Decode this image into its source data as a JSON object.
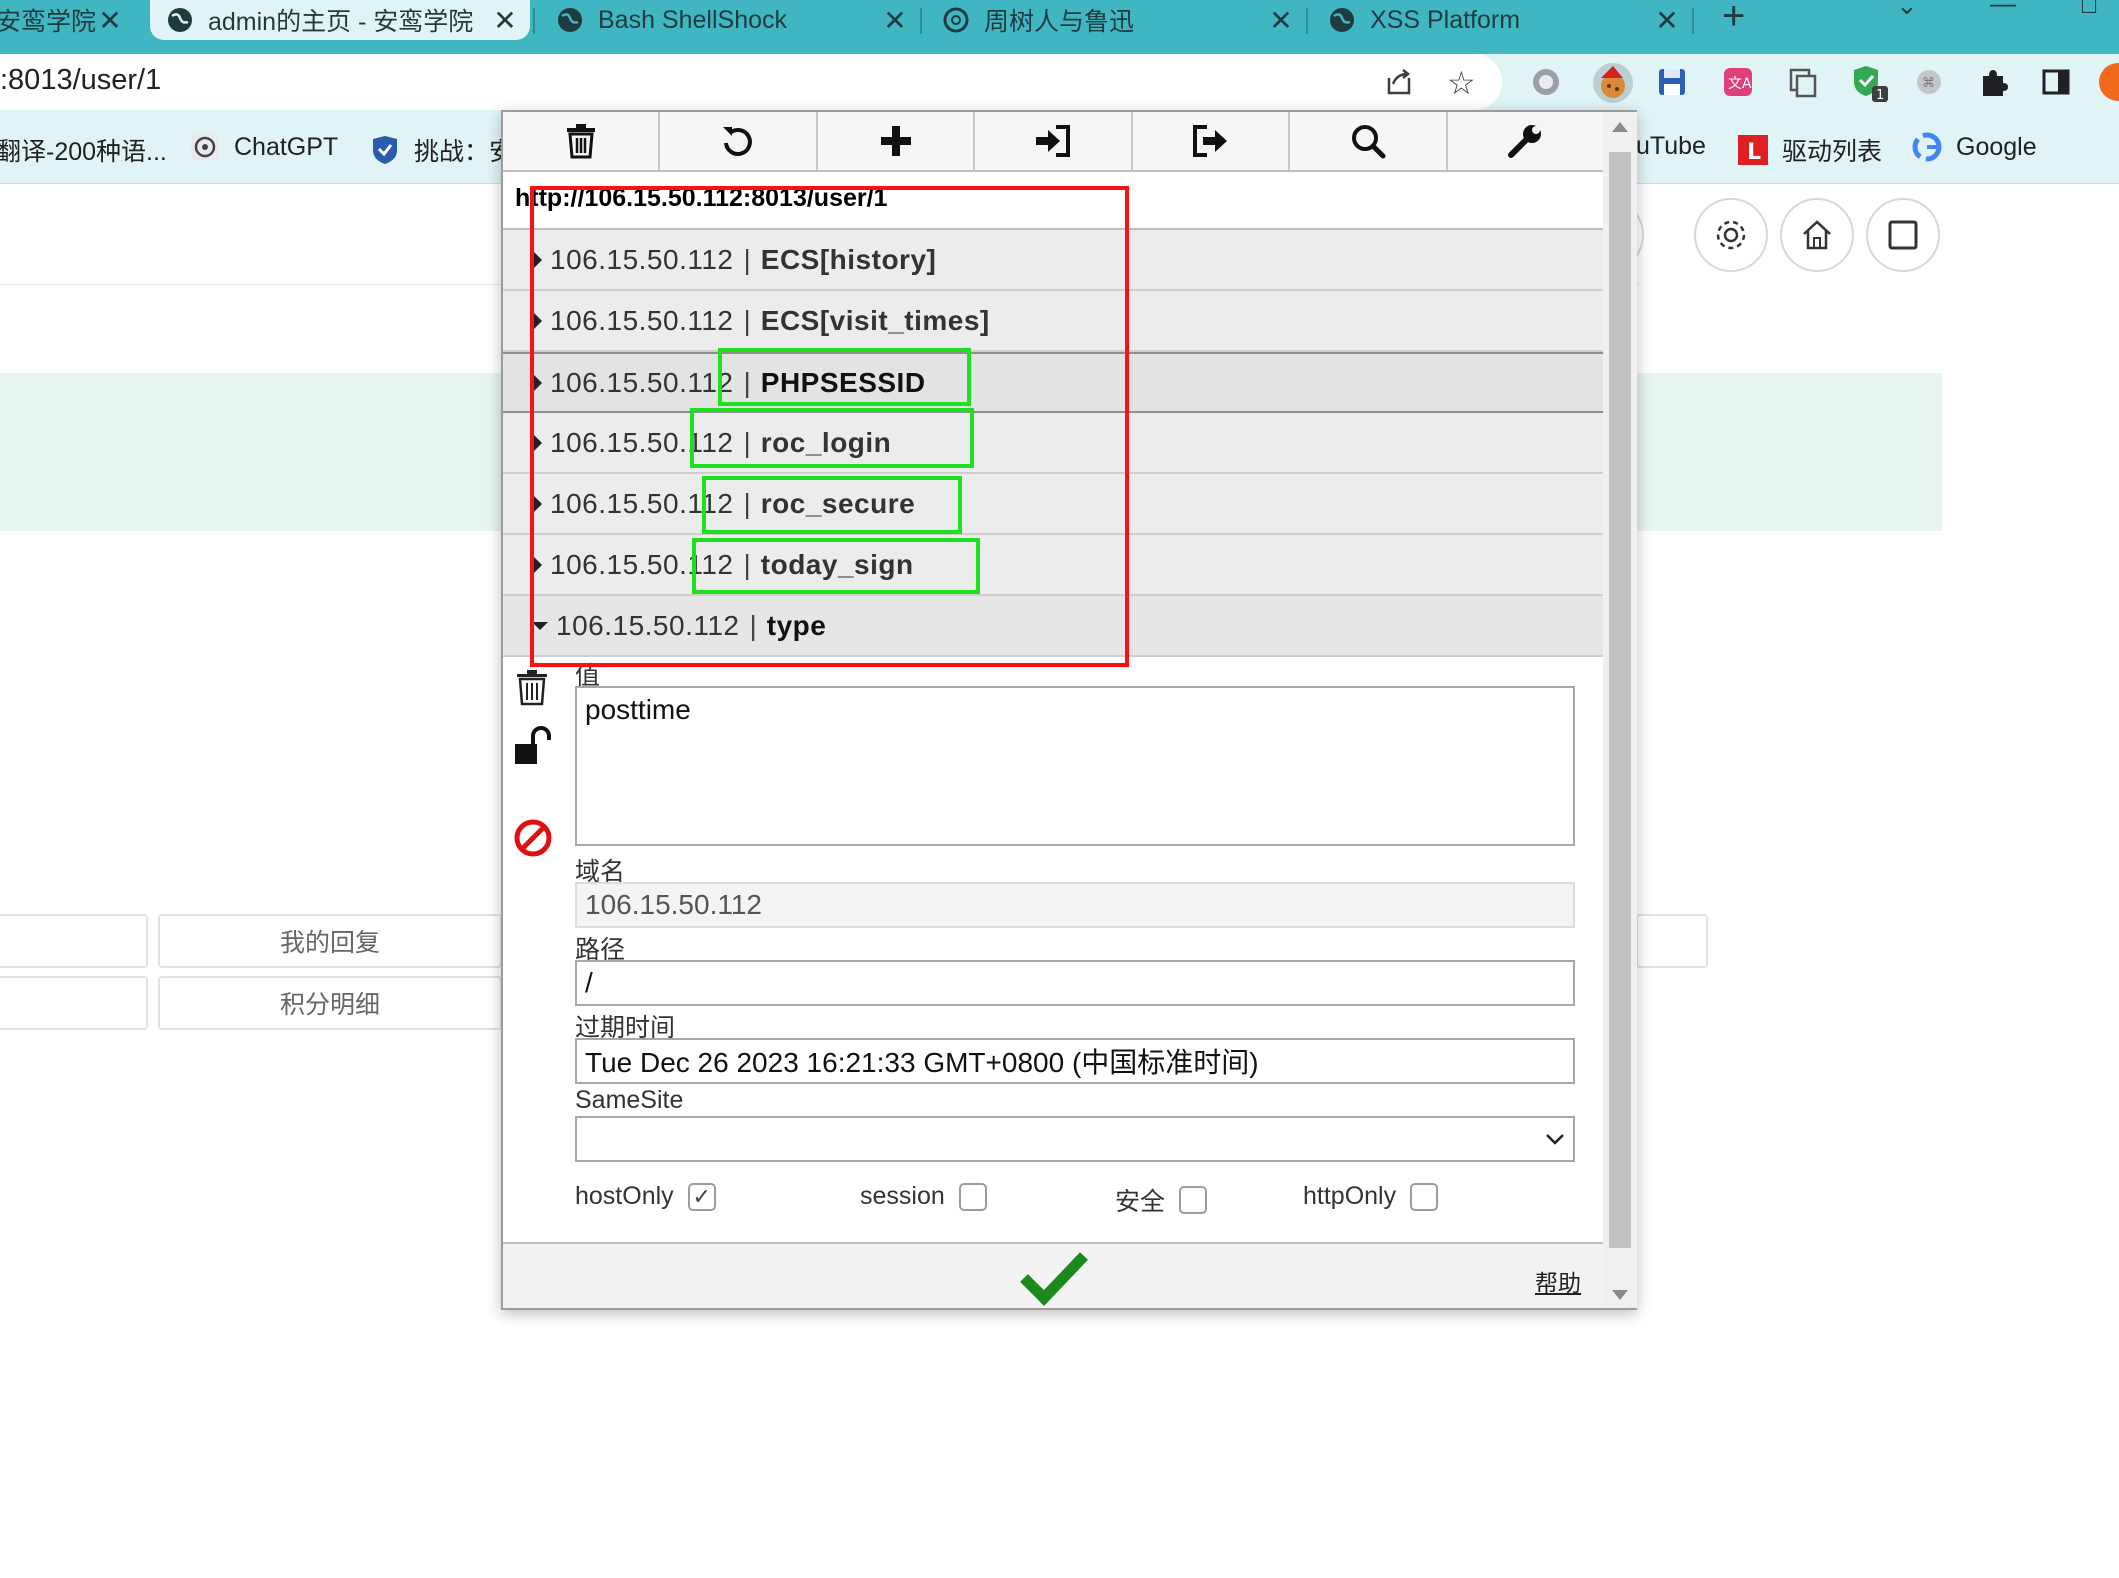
{
  "tabs": [
    {
      "label": "安鸾学院",
      "close": "✕"
    },
    {
      "label": "admin的主页 - 安鸾学院",
      "close": "✕"
    },
    {
      "label": "Bash ShellShock",
      "close": "✕"
    },
    {
      "label": "周树人与鲁迅",
      "close": "✕"
    },
    {
      "label": "XSS Platform",
      "close": "✕"
    }
  ],
  "new_tab_label": "+",
  "address_bar": {
    "url": ":8013/user/1"
  },
  "bookmarks": [
    {
      "label": "翻译-200种语..."
    },
    {
      "label": "ChatGPT"
    },
    {
      "label": "挑战：安"
    },
    {
      "label": "uTube"
    },
    {
      "label": "驱动列表"
    },
    {
      "label": "Google"
    }
  ],
  "page": {
    "buttons": [
      "我的回复",
      "积分明细"
    ]
  },
  "cookie_editor": {
    "url": "http://106.15.50.112:8013/user/1",
    "separator": "|",
    "cookies": [
      {
        "host": "106.15.50.112",
        "name": "ECS[history]"
      },
      {
        "host": "106.15.50.112",
        "name": "ECS[visit_times]"
      },
      {
        "host": "106.15.50.112",
        "name": "PHPSESSID"
      },
      {
        "host": "106.15.50.112",
        "name": "roc_login"
      },
      {
        "host": "106.15.50.112",
        "name": "roc_secure"
      },
      {
        "host": "106.15.50.112",
        "name": "today_sign"
      },
      {
        "host": "106.15.50.112",
        "name": "type"
      }
    ],
    "detail": {
      "value_label": "值",
      "value": "posttime",
      "domain_label": "域名",
      "domain": "106.15.50.112",
      "path_label": "路径",
      "path": "/",
      "expires_label": "过期时间",
      "expires": "Tue Dec 26 2023 16:21:33 GMT+0800 (中国标准时间)",
      "samesite_label": "SameSite",
      "samesite_value": "",
      "flags": [
        {
          "label": "hostOnly",
          "checked": true
        },
        {
          "label": "session",
          "checked": false
        },
        {
          "label": "安全",
          "checked": false
        },
        {
          "label": "httpOnly",
          "checked": false
        }
      ]
    },
    "help_label": "帮助"
  },
  "colors": {
    "tab_bar": "#3fb6c1",
    "toolbar": "#e0f4f6",
    "annotation_red": "#ff1010",
    "annotation_green": "#1ee01e",
    "save_check": "#1a8a1a",
    "block_icon": "#e01010"
  },
  "icons": [
    "trash-icon",
    "undo-icon",
    "add-icon",
    "import-icon",
    "export-icon",
    "search-icon",
    "wrench-icon",
    "lock-open-icon",
    "block-icon",
    "checkmark-icon",
    "gear-icon",
    "home-icon",
    "square-icon"
  ]
}
